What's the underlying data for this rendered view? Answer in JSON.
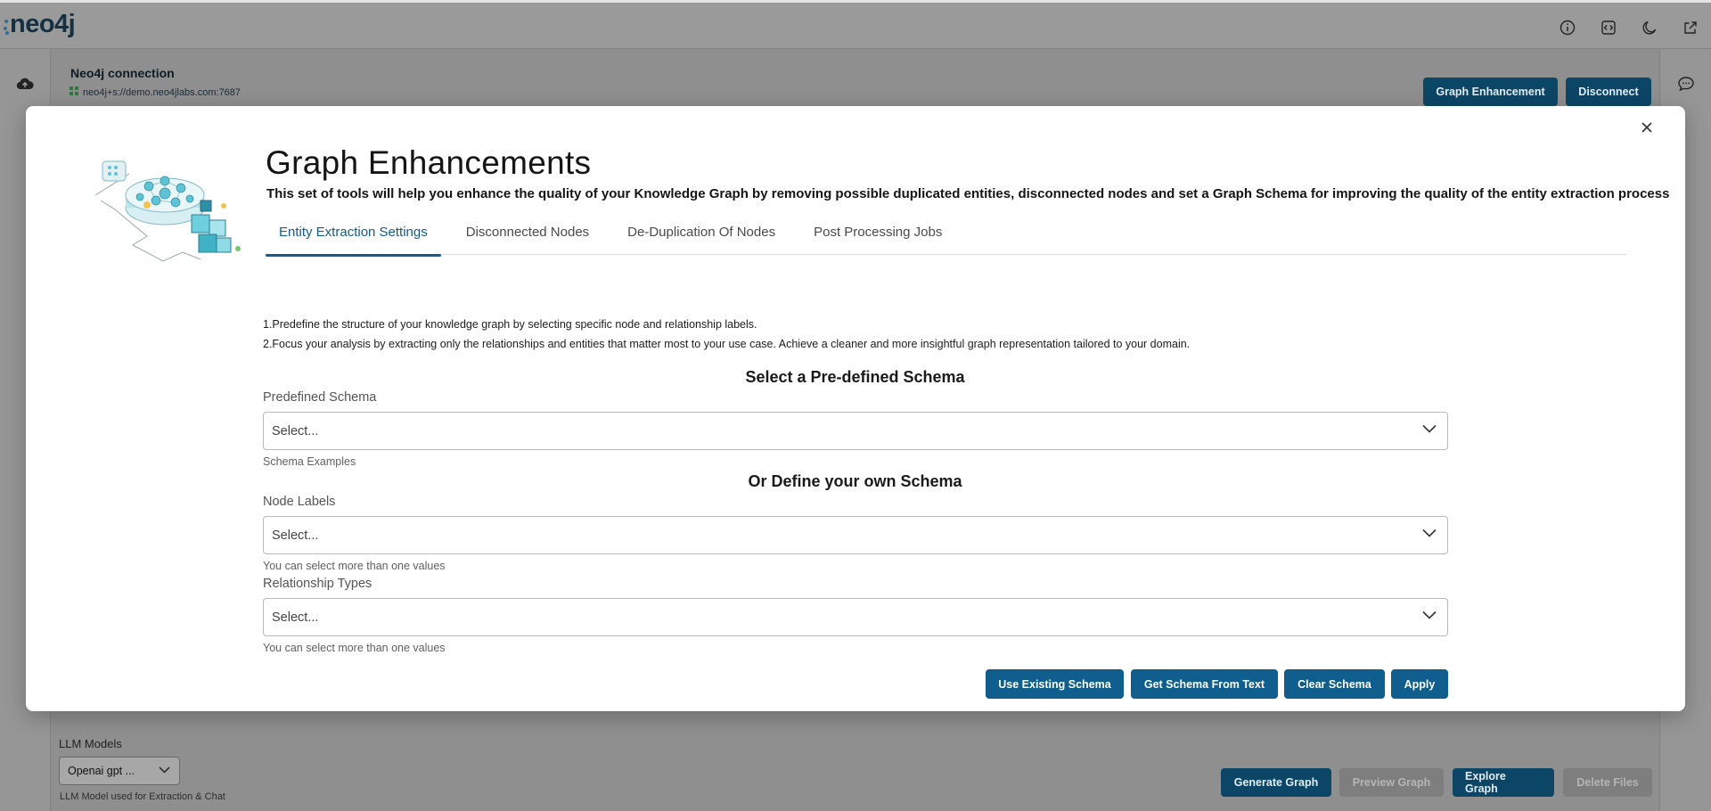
{
  "app": {
    "logo_text": "neo4j",
    "connection": {
      "title": "Neo4j connection",
      "uri": "neo4j+s://demo.neo4jlabs.com:7687"
    },
    "header_buttons": {
      "graph_enhancement": "Graph Enhancement",
      "disconnect": "Disconnect"
    },
    "llm": {
      "label": "LLM Models",
      "selected": "Openai gpt ...",
      "help": "LLM Model used for Extraction & Chat"
    },
    "footer_buttons": {
      "generate_graph": "Generate Graph",
      "preview_graph": "Preview Graph",
      "explore_graph": "Explore Graph",
      "delete_files": "Delete Files"
    },
    "icons": [
      "info-icon",
      "code-icon",
      "moon-icon",
      "external-link-icon",
      "cloud-upload-icon",
      "chat-icon"
    ]
  },
  "modal": {
    "title": "Graph Enhancements",
    "subtitle": "This set of tools will help you enhance the quality of your Knowledge Graph by removing possible duplicated entities, disconnected nodes and set a Graph Schema for improving the quality of the entity extraction process",
    "tabs": [
      {
        "label": "Entity Extraction Settings",
        "active": true
      },
      {
        "label": "Disconnected Nodes",
        "active": false
      },
      {
        "label": "De-Duplication Of Nodes",
        "active": false
      },
      {
        "label": "Post Processing Jobs",
        "active": false
      }
    ],
    "descriptions": [
      "1.Predefine the structure of your knowledge graph by selecting specific node and relationship labels.",
      "2.Focus your analysis by extracting only the relationships and entities that matter most to your use case. Achieve a cleaner and more insightful graph representation tailored to your domain."
    ],
    "predefined_heading": "Select a Pre-defined Schema",
    "predefined": {
      "label": "Predefined Schema",
      "placeholder": "Select...",
      "help": "Schema Examples"
    },
    "custom_heading": "Or Define your own Schema",
    "node_labels": {
      "label": "Node Labels",
      "placeholder": "Select...",
      "help": "You can select more than one values"
    },
    "relationship_types": {
      "label": "Relationship Types",
      "placeholder": "Select...",
      "help": "You can select more than one values"
    },
    "actions": {
      "use_existing": "Use Existing Schema",
      "from_text": "Get Schema From Text",
      "clear": "Clear Schema",
      "apply": "Apply"
    }
  },
  "colors": {
    "accent": "#0f5e8d",
    "overlay": "#8f8f8f",
    "modal_bg": "#ffffff"
  }
}
